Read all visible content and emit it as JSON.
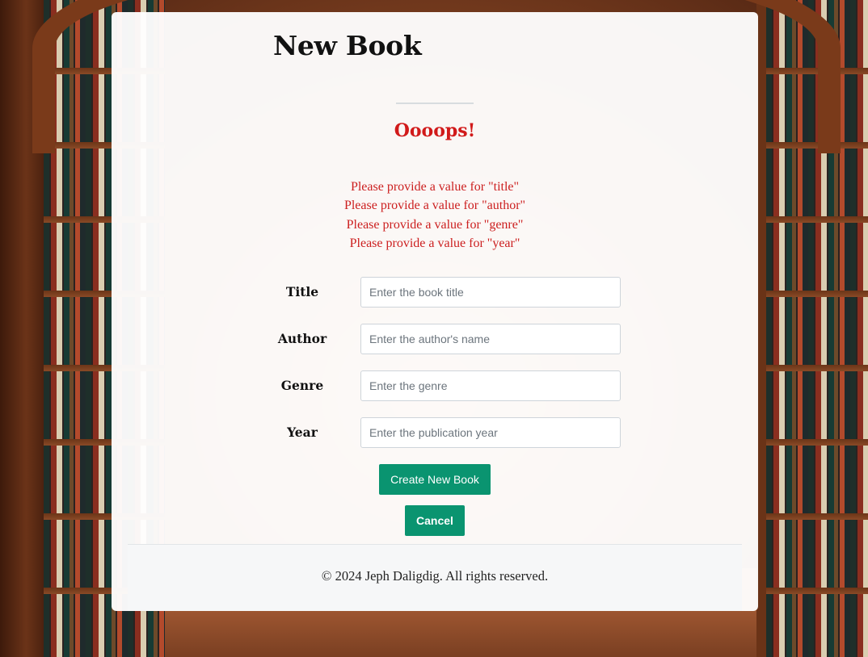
{
  "page": {
    "title": "New Book"
  },
  "errors": {
    "heading": "Oooops!",
    "messages": [
      "Please provide a value for \"title\"",
      "Please provide a value for \"author\"",
      "Please provide a value for \"genre\"",
      "Please provide a value for \"year\""
    ]
  },
  "form": {
    "fields": [
      {
        "label": "Title",
        "value": "",
        "placeholder": "Enter the book title"
      },
      {
        "label": "Author",
        "value": "",
        "placeholder": "Enter the author's name"
      },
      {
        "label": "Genre",
        "value": "",
        "placeholder": "Enter the genre"
      },
      {
        "label": "Year",
        "value": "",
        "placeholder": "Enter the publication year"
      }
    ],
    "submit_label": "Create New Book",
    "cancel_label": "Cancel"
  },
  "footer": {
    "text": "© 2024 Jeph Daligdig. All rights reserved."
  },
  "colors": {
    "error": "#d11a1a",
    "button": "#0a9470",
    "card": "#ffffff",
    "footer_bg": "#f6f7f8"
  }
}
